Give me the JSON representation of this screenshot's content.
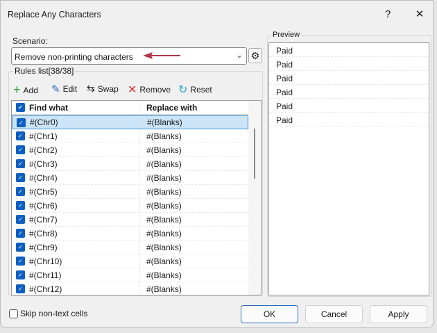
{
  "window": {
    "title": "Replace Any Characters",
    "help": "?",
    "close": "✕"
  },
  "scenario": {
    "label": "Scenario:",
    "value": "Remove non-printing characters",
    "annotation_color": "#b0384a"
  },
  "rules": {
    "label": "Rules list[38/38]",
    "toolbar": {
      "add": "Add",
      "edit": "Edit",
      "swap": "Swap",
      "remove": "Remove",
      "reset": "Reset"
    },
    "columns": [
      "Find what",
      "Replace with"
    ],
    "rows": [
      {
        "find": "#(Chr0)",
        "replace": "#(Blanks)"
      },
      {
        "find": "#(Chr1)",
        "replace": "#(Blanks)"
      },
      {
        "find": "#(Chr2)",
        "replace": "#(Blanks)"
      },
      {
        "find": "#(Chr3)",
        "replace": "#(Blanks)"
      },
      {
        "find": "#(Chr4)",
        "replace": "#(Blanks)"
      },
      {
        "find": "#(Chr5)",
        "replace": "#(Blanks)"
      },
      {
        "find": "#(Chr6)",
        "replace": "#(Blanks)"
      },
      {
        "find": "#(Chr7)",
        "replace": "#(Blanks)"
      },
      {
        "find": "#(Chr8)",
        "replace": "#(Blanks)"
      },
      {
        "find": "#(Chr9)",
        "replace": "#(Blanks)"
      },
      {
        "find": "#(Chr10)",
        "replace": "#(Blanks)"
      },
      {
        "find": "#(Chr11)",
        "replace": "#(Blanks)"
      },
      {
        "find": "#(Chr12)",
        "replace": "#(Blanks)"
      }
    ]
  },
  "preview": {
    "label": "Preview",
    "items": [
      "Paid",
      "Paid",
      "Paid",
      "Paid",
      "Paid",
      "Paid"
    ]
  },
  "footer": {
    "skip_label": "Skip non-text cells",
    "ok": "OK",
    "cancel": "Cancel",
    "apply": "Apply"
  }
}
